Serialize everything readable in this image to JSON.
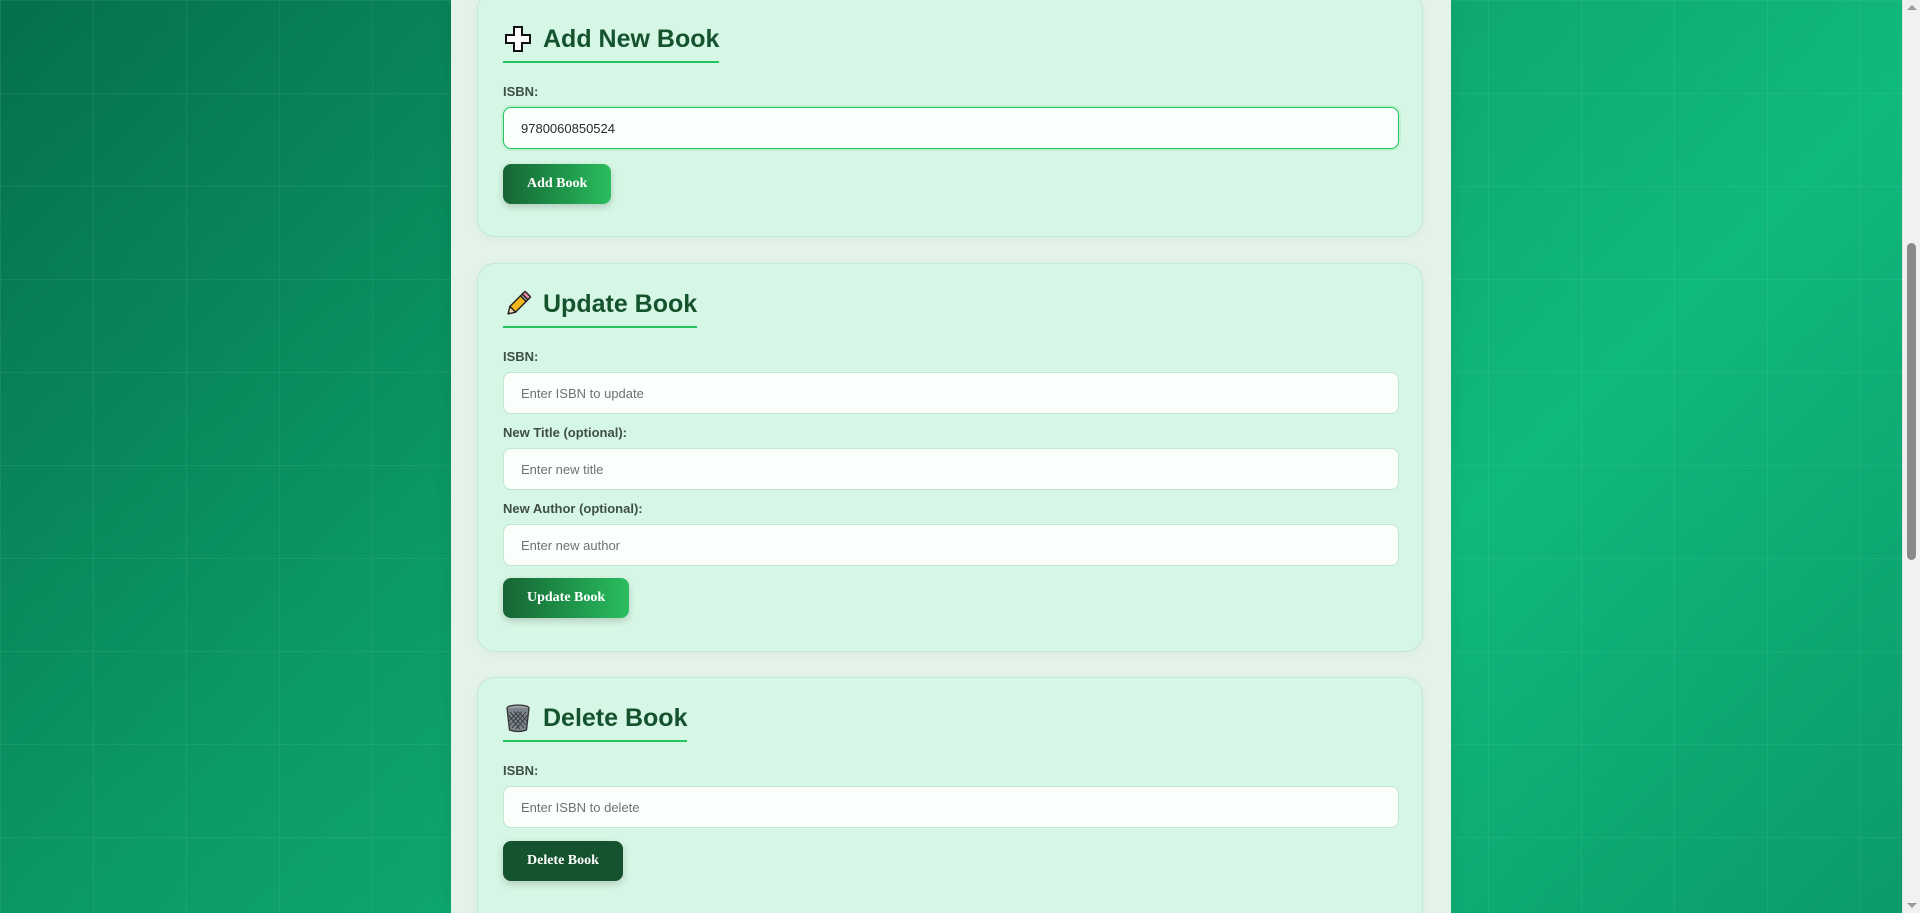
{
  "add_card": {
    "title": "Add New Book",
    "icon": "plus-icon",
    "isbn_label": "ISBN:",
    "isbn_value": "9780060850524",
    "button_label": "Add Book"
  },
  "update_card": {
    "title": "Update Book",
    "icon": "pencil-icon",
    "isbn_label": "ISBN:",
    "isbn_placeholder": "Enter ISBN to update",
    "title_label": "New Title (optional):",
    "title_placeholder": "Enter new title",
    "author_label": "New Author (optional):",
    "author_placeholder": "Enter new author",
    "button_label": "Update Book"
  },
  "delete_card": {
    "title": "Delete Book",
    "icon": "wastebasket-icon",
    "isbn_label": "ISBN:",
    "isbn_placeholder": "Enter ISBN to delete",
    "button_label": "Delete Book"
  },
  "colors": {
    "accent": "#22c55e",
    "heading": "#14532d",
    "card_background": "#d7f7e6",
    "page_background": "#0c9a66"
  }
}
